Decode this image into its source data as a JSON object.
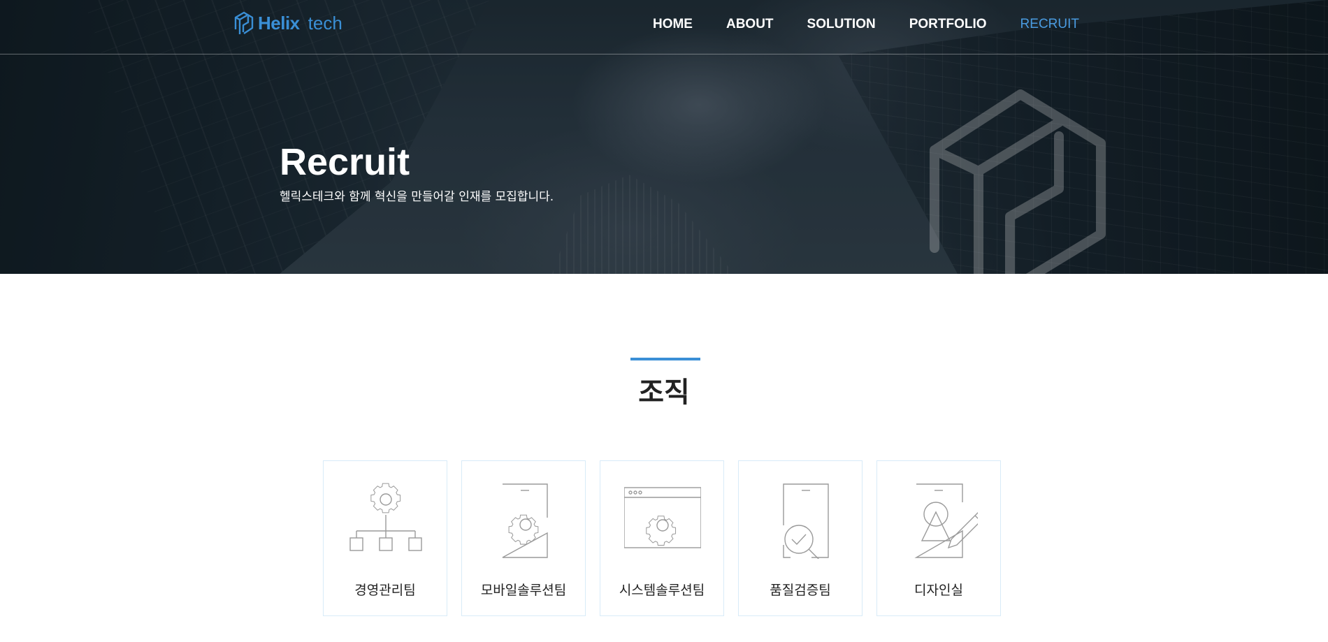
{
  "header": {
    "logo_bold": "Helix",
    "logo_light": "tech",
    "nav": [
      {
        "label": "HOME"
      },
      {
        "label": "ABOUT"
      },
      {
        "label": "SOLUTION"
      },
      {
        "label": "PORTFOLIO"
      },
      {
        "label": "RECRUIT",
        "active": true
      }
    ],
    "accent_color": "#3a8fd6"
  },
  "hero": {
    "title": "Recruit",
    "subtitle": "헬릭스테크와 함께 혁신을 만들어갈 인재를 모집합니다."
  },
  "section": {
    "title": "조직",
    "teams": [
      {
        "label": "경영관리팀",
        "icon": "org-chart-gear-icon"
      },
      {
        "label": "모바일솔루션팀",
        "icon": "mobile-gear-icon"
      },
      {
        "label": "시스템솔루션팀",
        "icon": "browser-gear-icon"
      },
      {
        "label": "품질검증팀",
        "icon": "document-magnifier-check-icon"
      },
      {
        "label": "디자인실",
        "icon": "design-pencil-icon"
      }
    ]
  }
}
